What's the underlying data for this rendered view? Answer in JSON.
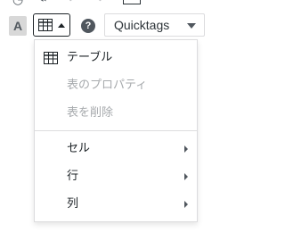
{
  "toolbar": {
    "text_color_label": "A",
    "table_button_icon": "table-icon",
    "help_label": "?",
    "format_select_value": "Quicktags"
  },
  "menu": {
    "items": [
      {
        "label": "テーブル",
        "icon": "table-icon",
        "disabled": false
      },
      {
        "label": "表のプロパティ",
        "disabled": true
      },
      {
        "label": "表を削除",
        "disabled": true
      },
      {
        "label": "セル",
        "has_submenu": true
      },
      {
        "label": "行",
        "has_submenu": true
      },
      {
        "label": "列",
        "has_submenu": true
      }
    ]
  },
  "colors": {
    "text": "#1d2327",
    "disabled_text": "#a7aaad",
    "border": "#dcdcde",
    "icon": "#50575e"
  }
}
